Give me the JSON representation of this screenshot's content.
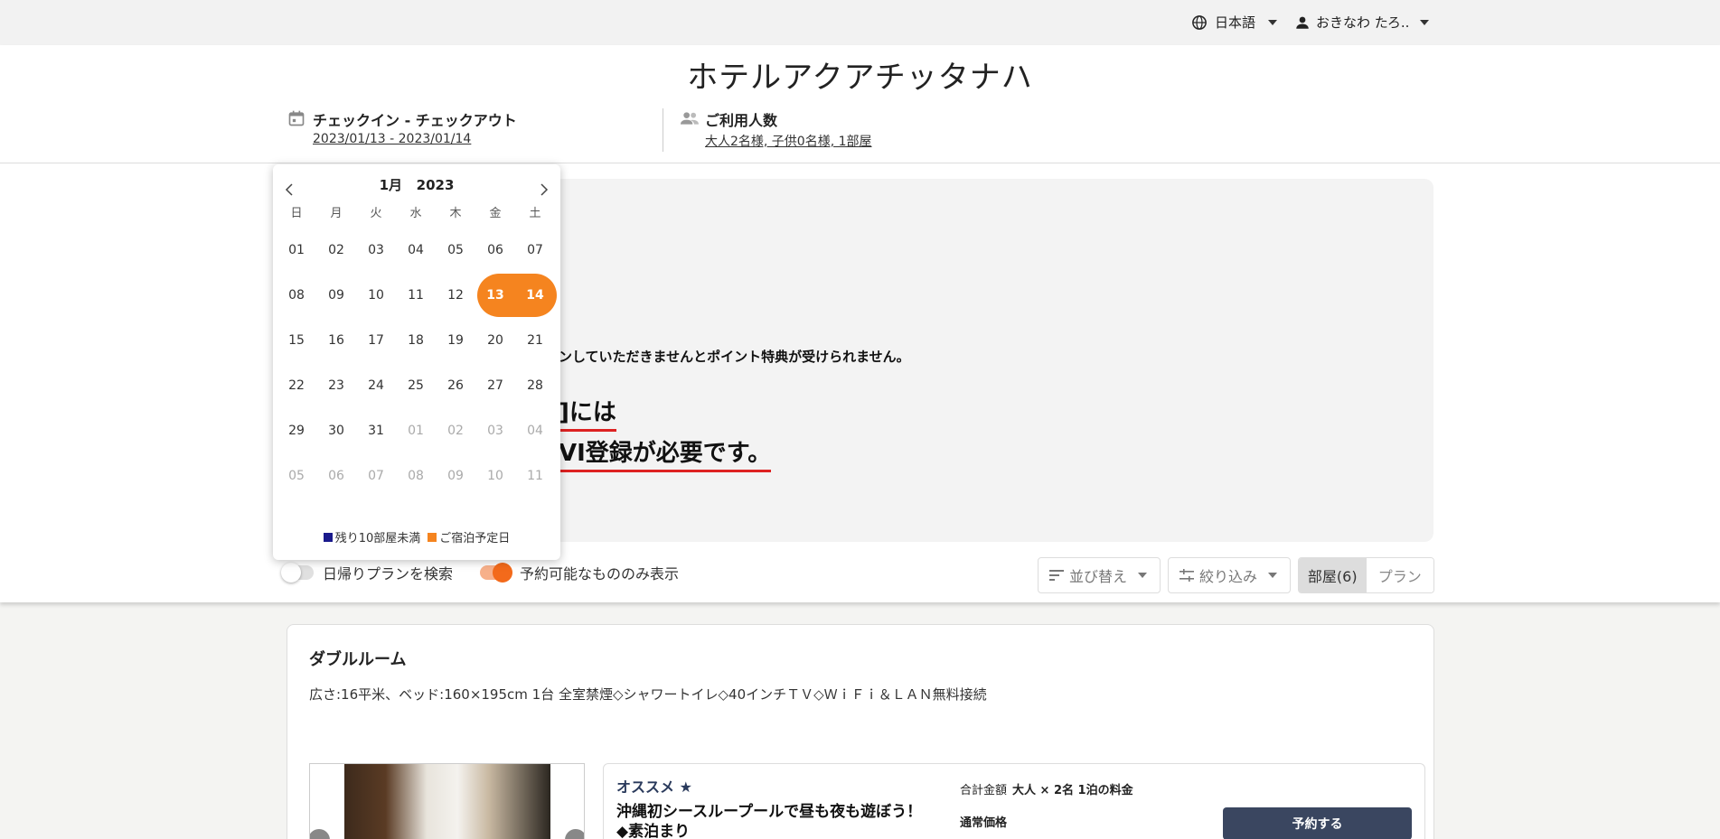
{
  "topbar": {
    "language": "日本語",
    "user_name": "おきなわ たろ.."
  },
  "hotel": {
    "name": "ホテルアクアチッタナハ"
  },
  "search": {
    "dates_label": "チェックイン - チェックアウト",
    "dates_value": "2023/01/13 - 2023/01/14",
    "guests_label": "ご利用人数",
    "guests_value": "大人2名様, 子供0名様, 1部屋"
  },
  "notice": {
    "line1": "ンしていただきませんとポイント特典が受けられません。",
    "big1": "]には",
    "big2": "VI登録が必要です。"
  },
  "calendar": {
    "month_label": "1月",
    "year_label": "2023",
    "weekdays": [
      "日",
      "月",
      "火",
      "水",
      "木",
      "金",
      "土"
    ],
    "weeks": [
      [
        "01",
        "02",
        "03",
        "04",
        "05",
        "06",
        "07"
      ],
      [
        "08",
        "09",
        "10",
        "11",
        "12",
        "13",
        "14"
      ],
      [
        "15",
        "16",
        "17",
        "18",
        "19",
        "20",
        "21"
      ],
      [
        "22",
        "23",
        "24",
        "25",
        "26",
        "27",
        "28"
      ],
      [
        "29",
        "30",
        "31",
        "01",
        "02",
        "03",
        "04"
      ],
      [
        "05",
        "06",
        "07",
        "08",
        "09",
        "10",
        "11"
      ]
    ],
    "selected": [
      "13",
      "14"
    ],
    "legend_low": "残り10部屋未満",
    "legend_stay": "ご宿泊予定日",
    "colors": {
      "low": "#1a1a8c",
      "stay": "#f5841f"
    }
  },
  "filters": {
    "day_trip_label": "日帰りプランを検索",
    "day_trip_on": false,
    "available_only_label": "予約可能なもののみ表示",
    "available_only_on": true,
    "sort_label": "並び替え",
    "filter_label": "絞り込み",
    "rooms_tab": "部屋(6)",
    "plans_tab": "プラン"
  },
  "room": {
    "title": "ダブルルーム",
    "description": "広さ:16平米、ベッド:160×195cm 1台 全室禁煙◇シャワートイレ◇40インチＴＶ◇ＷｉＦｉ＆ＬＡＮ無料接続",
    "plan": {
      "recommend": "オススメ ★",
      "name": "沖縄初シースループールで昼も夜も遊ぼう！◆素泊まり",
      "total_label": "合計金額",
      "total_detail": "大人 × 2名 1泊の料金",
      "normal_price_label": "通常価格",
      "reserve_button": "予約する"
    }
  },
  "colors": {
    "accent": "#f5841f",
    "button_dark": "#3a4660"
  }
}
